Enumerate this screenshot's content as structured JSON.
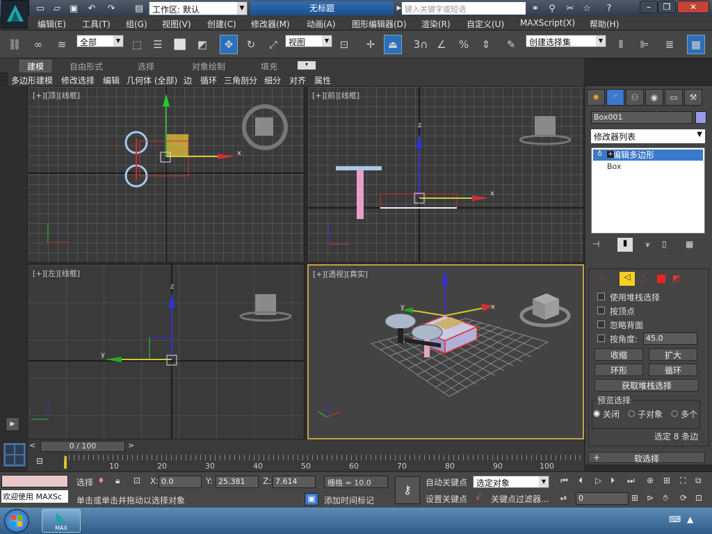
{
  "title_bar": {
    "workspace": "工作区: 默认",
    "document_title": "无标题",
    "search_placeholder": "键入关键字或短语"
  },
  "menu": [
    "编辑(E)",
    "工具(T)",
    "组(G)",
    "视图(V)",
    "创建(C)",
    "修改器(M)",
    "动画(A)",
    "图形编辑器(D)",
    "渲染(R)",
    "自定义(U)",
    "MAXScript(X)",
    "帮助(H)"
  ],
  "toolbar": {
    "filter": "全部",
    "ref_coord": "视图",
    "named_selection": "创建选择集",
    "snap_label": "3",
    "percent_label": "%"
  },
  "ribbon": {
    "tabs": [
      "建模",
      "自由形式",
      "选择",
      "对象绘制",
      "填充"
    ],
    "sub": [
      "多边形建模",
      "修改选择",
      "编辑",
      "几何体 (全部)",
      "边",
      "循环",
      "三角剖分",
      "细分",
      "对齐",
      "属性"
    ]
  },
  "viewports": {
    "top": {
      "l1": "[+]",
      "l2": "[顶]",
      "l3": "[线框]"
    },
    "front": {
      "l1": "[+]",
      "l2": "[前]",
      "l3": "[线框]"
    },
    "left": {
      "l1": "[+]",
      "l2": "[左]",
      "l3": "[线框]"
    },
    "persp": {
      "l1": "[+]",
      "l2": "[透视]",
      "l3": "[真实]"
    },
    "axis": {
      "x": "x",
      "y": "y",
      "z": "z"
    },
    "cube": {
      "front": "前",
      "left": "左",
      "top": "上"
    }
  },
  "command_panel": {
    "object_name": "Box001",
    "modifier_list": "修改器列表",
    "stack": [
      "编辑多边形",
      "Box"
    ],
    "options": [
      "使用堆栈选择",
      "按顶点",
      "忽略背面",
      "按角度:"
    ],
    "angle": "45.0",
    "buttons": {
      "shrink": "收缩",
      "grow": "扩大",
      "ring": "环形",
      "loop": "循环",
      "get_stack": "获取堆栈选择"
    },
    "preview": {
      "title": "预览选择",
      "off": "关闭",
      "subobj": "子对象",
      "multi": "多个"
    },
    "selected_info": "选定 8 条边",
    "soft_selection": "软选择",
    "plus": "+"
  },
  "timeline": {
    "frame": "0 / 100",
    "ticks": [
      "10",
      "20",
      "30",
      "40",
      "50",
      "60",
      "70",
      "80",
      "90",
      "100"
    ]
  },
  "status": {
    "welcome": "欢迎使用 MAXSc",
    "select_label": "选择",
    "x_label": "X:",
    "x": "0.0",
    "y_label": "Y:",
    "y": "25.381",
    "z_label": "Z:",
    "z": "7.614",
    "grid": "栅格 = 10.0",
    "hint": "单击或单击并拖动以选择对象",
    "add_tag": "添加时间标记",
    "auto_key": "自动关键点",
    "set_key": "设置关键点",
    "key_mode": "选定对象",
    "key_filter": "关键点过滤器...",
    "frame_value": "0"
  },
  "taskbar": {
    "app_label": "MAX"
  }
}
